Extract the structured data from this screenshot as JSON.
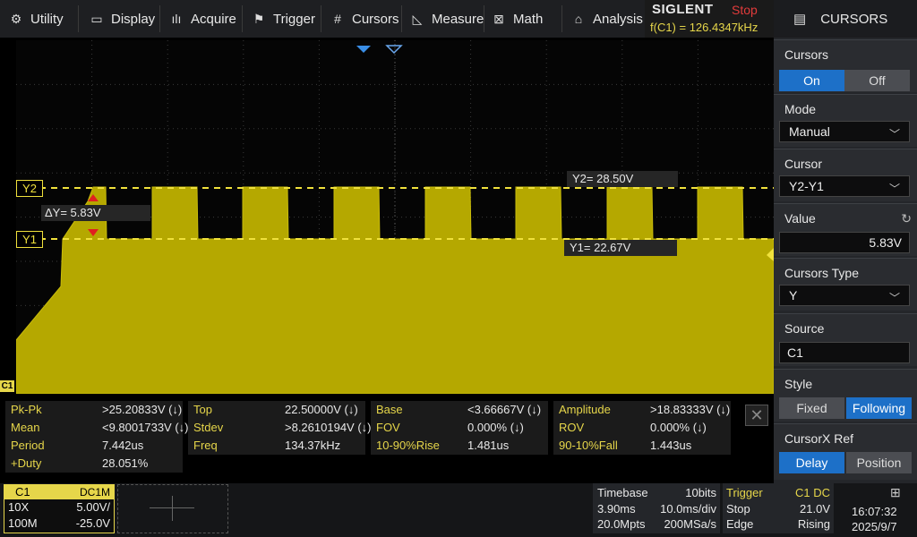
{
  "menu": {
    "items": [
      {
        "label": "Utility",
        "icon": "utility-icon"
      },
      {
        "label": "Display",
        "icon": "display-icon"
      },
      {
        "label": "Acquire",
        "icon": "acquire-icon"
      },
      {
        "label": "Trigger",
        "icon": "trigger-flag-icon"
      },
      {
        "label": "Cursors",
        "icon": "cursors-icon"
      },
      {
        "label": "Measure",
        "icon": "measure-icon"
      },
      {
        "label": "Math",
        "icon": "math-icon"
      },
      {
        "label": "Analysis",
        "icon": "analysis-icon"
      }
    ]
  },
  "status": {
    "brand": "SIGLENT",
    "run_state": "Stop",
    "cursor_freq": "f(C1) = 126.4347kHz"
  },
  "panel": {
    "title": "CURSORS",
    "cursors": {
      "label": "Cursors",
      "on": "On",
      "off": "Off"
    },
    "mode": {
      "label": "Mode",
      "value": "Manual"
    },
    "cursor": {
      "label": "Cursor",
      "value": "Y2-Y1"
    },
    "value": {
      "label": "Value",
      "value": "5.83V"
    },
    "cursors_type": {
      "label": "Cursors Type",
      "value": "Y"
    },
    "source": {
      "label": "Source",
      "value": "C1"
    },
    "style": {
      "label": "Style",
      "fixed": "Fixed",
      "following": "Following"
    },
    "cursorx_ref": {
      "label": "CursorX Ref",
      "delay": "Delay",
      "position": "Position"
    }
  },
  "scope": {
    "y2_tag": "Y2",
    "y1_tag": "Y1",
    "delta_y": "ΔY= 5.83V",
    "y2_readout": "Y2= 28.50V",
    "y1_readout": "Y1= 22.67V",
    "ch_marker": "C1",
    "waveform_color": "#b5a800",
    "cursor_color": "#f0e13c",
    "high_level_v": 28.5,
    "low_level_v": 22.67,
    "pulse_count": 8,
    "duty": 0.28
  },
  "measurements": {
    "rows": [
      [
        [
          "Pk-Pk",
          ">25.20833V (↓)"
        ],
        [
          "Top",
          "22.50000V (↓)"
        ],
        [
          "Base",
          "<3.66667V (↓)"
        ],
        [
          "Amplitude",
          ">18.83333V (↓)"
        ]
      ],
      [
        [
          "Mean",
          "<9.8001733V (↓)"
        ],
        [
          "Stdev",
          ">8.2610194V (↓)"
        ],
        [
          "FOV",
          "0.000% (↓)"
        ],
        [
          "ROV",
          "0.000% (↓)"
        ]
      ],
      [
        [
          "Period",
          "7.442us"
        ],
        [
          "Freq",
          "134.37kHz"
        ],
        [
          "10-90%Rise",
          "1.481us"
        ],
        [
          "90-10%Fall",
          "1.443us"
        ]
      ],
      [
        [
          "+Duty",
          "28.051%"
        ],
        [
          "",
          ""
        ],
        [
          "",
          ""
        ],
        [
          "",
          ""
        ]
      ]
    ]
  },
  "channel": {
    "name": "C1",
    "coupling": "DC1M",
    "probe": "10X",
    "scale": "5.00V/",
    "bw": "100M",
    "offset": "-25.0V"
  },
  "timebase": {
    "label": "Timebase",
    "bits": "10bits",
    "delay": "3.90ms",
    "scale": "10.0ms/div",
    "points": "20.0Mpts",
    "rate": "200MSa/s"
  },
  "trigger": {
    "label": "Trigger",
    "source": "C1 DC",
    "mode": "Stop",
    "level": "21.0V",
    "type": "Edge",
    "slope": "Rising"
  },
  "clock": {
    "time": "16:07:32",
    "date": "2025/9/7"
  }
}
